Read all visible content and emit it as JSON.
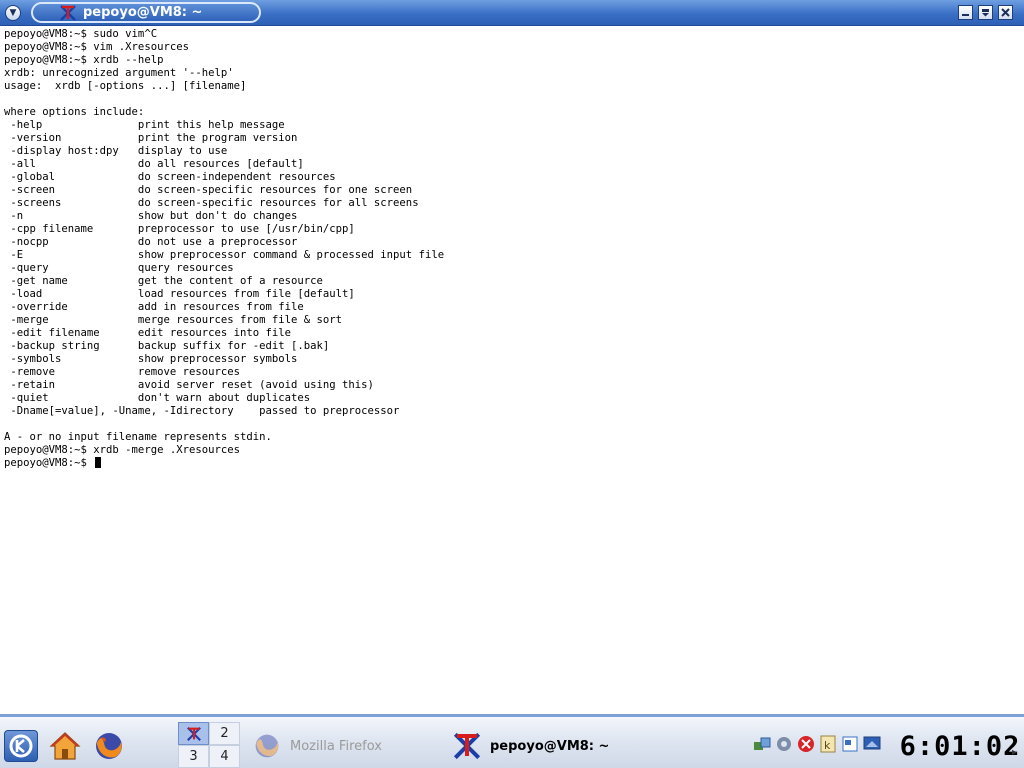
{
  "window": {
    "title": "pepoyo@VM8: ~",
    "menu_icon": "chevron-down-icon",
    "buttons": [
      "minimize-icon",
      "maximize-icon",
      "close-icon"
    ]
  },
  "terminal": {
    "lines": [
      "pepoyo@VM8:~$ sudo vim^C",
      "pepoyo@VM8:~$ vim .Xresources",
      "pepoyo@VM8:~$ xrdb --help",
      "xrdb: unrecognized argument '--help'",
      "usage:  xrdb [-options ...] [filename]",
      "",
      "where options include:",
      " -help               print this help message",
      " -version            print the program version",
      " -display host:dpy   display to use",
      " -all                do all resources [default]",
      " -global             do screen-independent resources",
      " -screen             do screen-specific resources for one screen",
      " -screens            do screen-specific resources for all screens",
      " -n                  show but don't do changes",
      " -cpp filename       preprocessor to use [/usr/bin/cpp]",
      " -nocpp              do not use a preprocessor",
      " -E                  show preprocessor command & processed input file",
      " -query              query resources",
      " -get name           get the content of a resource",
      " -load               load resources from file [default]",
      " -override           add in resources from file",
      " -merge              merge resources from file & sort",
      " -edit filename      edit resources into file",
      " -backup string      backup suffix for -edit [.bak]",
      " -symbols            show preprocessor symbols",
      " -remove             remove resources",
      " -retain             avoid server reset (avoid using this)",
      " -quiet              don't warn about duplicates",
      " -Dname[=value], -Uname, -Idirectory    passed to preprocessor",
      "",
      "A - or no input filename represents stdin.",
      "pepoyo@VM8:~$ xrdb -merge .Xresources"
    ],
    "prompt": "pepoyo@VM8:~$ "
  },
  "taskbar": {
    "launchers": [
      {
        "name": "kmenu",
        "icon": "kde-menu-icon"
      },
      {
        "name": "home",
        "icon": "home-folder-icon"
      },
      {
        "name": "firefox",
        "icon": "firefox-icon"
      }
    ],
    "pager": [
      "",
      "2",
      "3",
      "4"
    ],
    "tasks": [
      {
        "label": "Mozilla Firefox",
        "icon": "firefox-icon"
      },
      {
        "label": "pepoyo@VM8: ~",
        "icon": "xterm-icon"
      }
    ],
    "tray_icons": [
      "network-icon",
      "shield-icon",
      "warning-icon",
      "kde-app-icon",
      "notes-icon",
      "screen-icon"
    ],
    "clock": "6:01:02"
  },
  "colors": {
    "titlebar": "#3a6fc6",
    "taskbar_border": "#7da0d9",
    "terminal_bg": "#ffffff",
    "terminal_fg": "#000000"
  }
}
